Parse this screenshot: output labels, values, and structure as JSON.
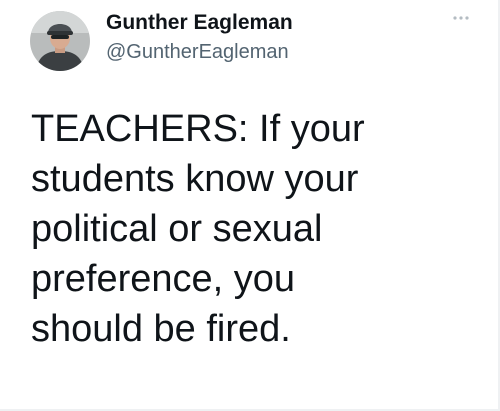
{
  "tweet": {
    "author_name": "Gunther Eagleman",
    "author_handle": "@GuntherEagleman",
    "text": "TEACHERS: If your\nstudents know your\npolitical or sexual\npreference, you\nshould be fired."
  },
  "icons": {
    "avatar": "profile-photo",
    "more": "more-horizontal-icon"
  },
  "colors": {
    "text_primary": "#0f1419",
    "text_secondary": "#536471",
    "background": "#ffffff"
  }
}
